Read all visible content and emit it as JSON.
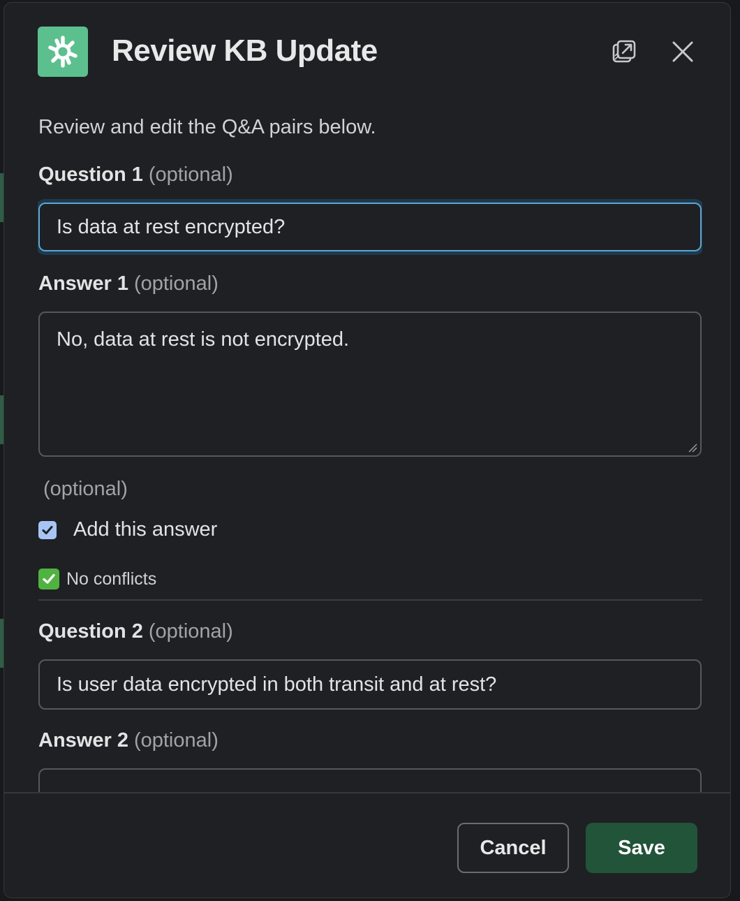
{
  "dialog": {
    "title": "Review KB Update",
    "intro": "Review and edit the Q&A pairs below."
  },
  "pairs": [
    {
      "question_label": "Question 1",
      "question_optional": "(optional)",
      "question_value": "Is data at rest encrypted?",
      "answer_label": "Answer 1",
      "answer_optional": "(optional)",
      "answer_value": "No, data at rest is not encrypted.",
      "extra_optional": "(optional)",
      "checkbox_label": "Add this answer",
      "checkbox_checked": true,
      "status": "No conflicts"
    },
    {
      "question_label": "Question 2",
      "question_optional": "(optional)",
      "question_value": "Is user data encrypted in both transit and at rest?",
      "answer_label": "Answer 2",
      "answer_optional": "(optional)"
    }
  ],
  "footer": {
    "cancel_label": "Cancel",
    "save_label": "Save"
  },
  "icons": {
    "logo": "app-logo-icon",
    "popout": "popout-icon",
    "close": "close-icon",
    "checkbox": "checkmark-icon",
    "status": "check-mark-button-emoji"
  },
  "colors": {
    "logo_bg": "#5cbf8e",
    "focus_ring": "#5ba8d4",
    "save_bg": "#215439",
    "checkbox_bg": "#a7c5f4",
    "status_check_bg": "#4fb33f"
  }
}
